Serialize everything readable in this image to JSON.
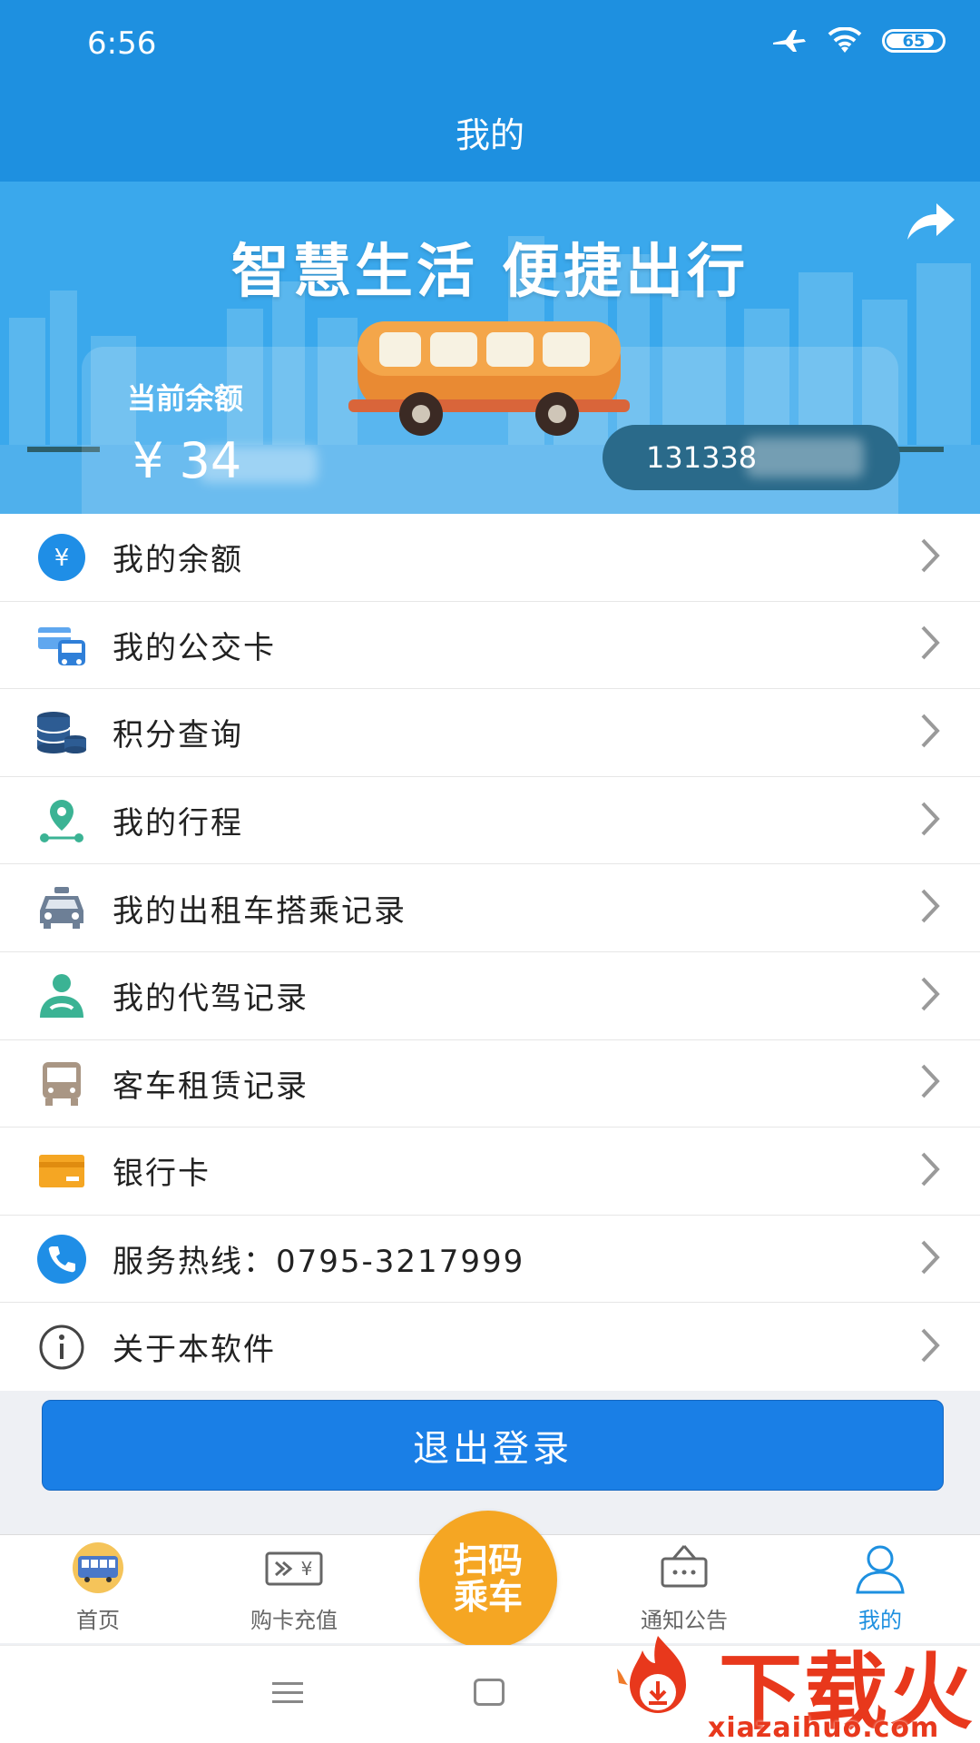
{
  "status_bar": {
    "time": "6:56",
    "battery": "65"
  },
  "header": {
    "title": "我的"
  },
  "banner": {
    "slogan": "智慧生活  便捷出行",
    "balance_label": "当前余额",
    "balance_value": "¥ 34",
    "phone": "131338"
  },
  "menu": [
    {
      "label": "我的余额",
      "icon": "yuan-icon"
    },
    {
      "label": "我的公交卡",
      "icon": "bus-card-icon"
    },
    {
      "label": "积分查询",
      "icon": "coins-icon"
    },
    {
      "label": "我的行程",
      "icon": "route-pin-icon"
    },
    {
      "label": "我的出租车搭乘记录",
      "icon": "taxi-icon"
    },
    {
      "label": "我的代驾记录",
      "icon": "driver-icon"
    },
    {
      "label": "客车租赁记录",
      "icon": "coach-icon"
    },
    {
      "label": "银行卡",
      "icon": "bank-card-icon"
    },
    {
      "label": "服务热线：0795-3217999",
      "icon": "phone-icon"
    },
    {
      "label": "关于本软件",
      "icon": "info-icon"
    }
  ],
  "logout": {
    "label": "退出登录"
  },
  "tabbar": {
    "home": "首页",
    "buy": "购卡充值",
    "scan_line1": "扫码",
    "scan_line2": "乘车",
    "notice": "通知公告",
    "mine": "我的"
  },
  "watermark": {
    "text": "下载火",
    "url": "xiazaihuo.com"
  },
  "colors": {
    "primary": "#1e90e0",
    "button": "#1a7fe6",
    "accent": "#f5a623",
    "watermark": "#e8381c"
  }
}
